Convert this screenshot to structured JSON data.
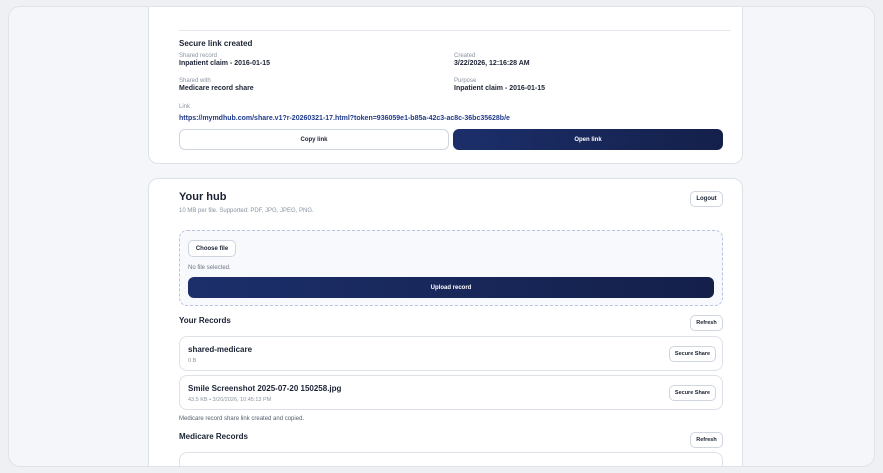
{
  "secure_link": {
    "heading": "Secure link created",
    "shared_record_label": "Shared record",
    "shared_record_value": "Inpatient claim - 2016-01-15",
    "created_label": "Created",
    "created_value": "3/22/2026, 12:16:28 AM",
    "shared_with_label": "Shared with",
    "shared_with_value": "Medicare record share",
    "purpose_label": "Purpose",
    "purpose_value": "Inpatient claim - 2016-01-15",
    "link_label": "Link",
    "link_value": "https://mymdhub.com/share.v1?r-20260321-17.html?token=936059e1-b85a-42c3-ac8c-36bc35628b/e",
    "copy_label": "Copy link",
    "open_label": "Open link"
  },
  "hub": {
    "title": "Your hub",
    "subtitle": "10 MB per file. Supported: PDF, JPG, JPEG, PNG.",
    "logout_label": "Logout",
    "choose_file_label": "Choose file",
    "no_file_text": "No file selected.",
    "upload_label": "Upload record"
  },
  "records": {
    "title": "Your Records",
    "refresh_label": "Refresh",
    "items": [
      {
        "name": "shared-medicare",
        "meta": "0 B",
        "action": "Secure Share"
      },
      {
        "name": "Smile Screenshot 2025-07-20 150258.jpg",
        "meta": "43.5 KB • 3/20/2026, 10:45:13 PM",
        "action": "Secure Share"
      }
    ],
    "status_note": "Medicare record share link created and copied."
  },
  "medicare": {
    "title": "Medicare Records",
    "refresh_label": "Refresh"
  },
  "colors": {
    "primary_dark": "#14204a",
    "link": "#1f3a8a",
    "upload_border": "#b9c3e0"
  }
}
